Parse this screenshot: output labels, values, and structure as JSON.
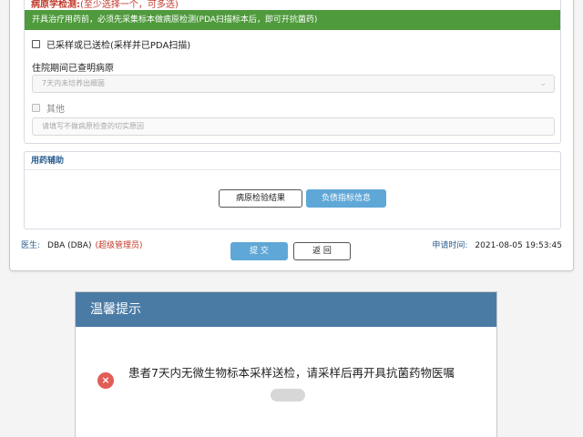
{
  "form": {
    "exam_title": "病原学检测:",
    "exam_hint": "(至少选择一个，可多选)",
    "notice": "开具治疗用药前，必须先采集标本做病原检测(PDA扫描标本后，即可开抗菌药)",
    "checkbox_sampled": "已采样或已送检(采样并已PDA扫描)",
    "hospital_label": "住院期间已查明病原",
    "select_value": "7天内未培养出细菌",
    "select_chevron": "chevron-down-icon",
    "checkbox_other": "其他",
    "reason_placeholder": "请填写不做病原检查的切实原因"
  },
  "assist": {
    "title": "用药辅助",
    "btn_result": "病原检验结果",
    "btn_indicator": "负债指标信息"
  },
  "footer": {
    "doctor_label": "医生:",
    "doctor_name": "DBA (DBA)",
    "doctor_role": "(超级管理员)",
    "submit_label": "提 交",
    "back_label": "返 回",
    "time_label": "申请时间:",
    "time_value": "2021-08-05 19:53:45"
  },
  "dialog": {
    "title": "温馨提示",
    "icon": "error-icon",
    "icon_glyph": "×",
    "message": "患者7天内无微生物标本采样送检，请采样后再开具抗菌药物医嘱"
  },
  "colors": {
    "notice_bar": "#4f9a3c",
    "primary_button": "#5fa7d6",
    "dialog_header": "#4a7ba5",
    "error_icon": "#e25d58",
    "warning_text": "#c0392b"
  }
}
